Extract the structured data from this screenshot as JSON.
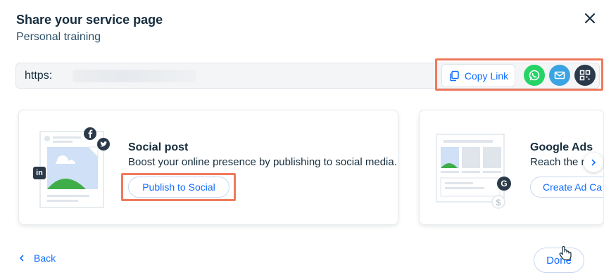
{
  "header": {
    "title": "Share your service page",
    "subtitle": "Personal training"
  },
  "link": {
    "url_prefix": "https:",
    "copy_label": "Copy Link"
  },
  "share_icons": [
    {
      "icon": "whatsapp-icon",
      "color": "#25d366"
    },
    {
      "icon": "mail-icon",
      "color": "#3aa3e3"
    },
    {
      "icon": "qr-code-icon",
      "color": "#2b3a4a"
    }
  ],
  "cards": [
    {
      "title": "Social post",
      "description": "Boost your online presence by publishing to social media.",
      "button_label": "Publish to Social"
    },
    {
      "title": "Google Ads",
      "description": "Reach the ri",
      "button_label": "Create Ad Ca"
    }
  ],
  "footer": {
    "back_label": "Back",
    "done_label": "Done"
  },
  "colors": {
    "accent": "#116dff",
    "highlight": "#ef7a5d",
    "text": "#162d3d"
  }
}
